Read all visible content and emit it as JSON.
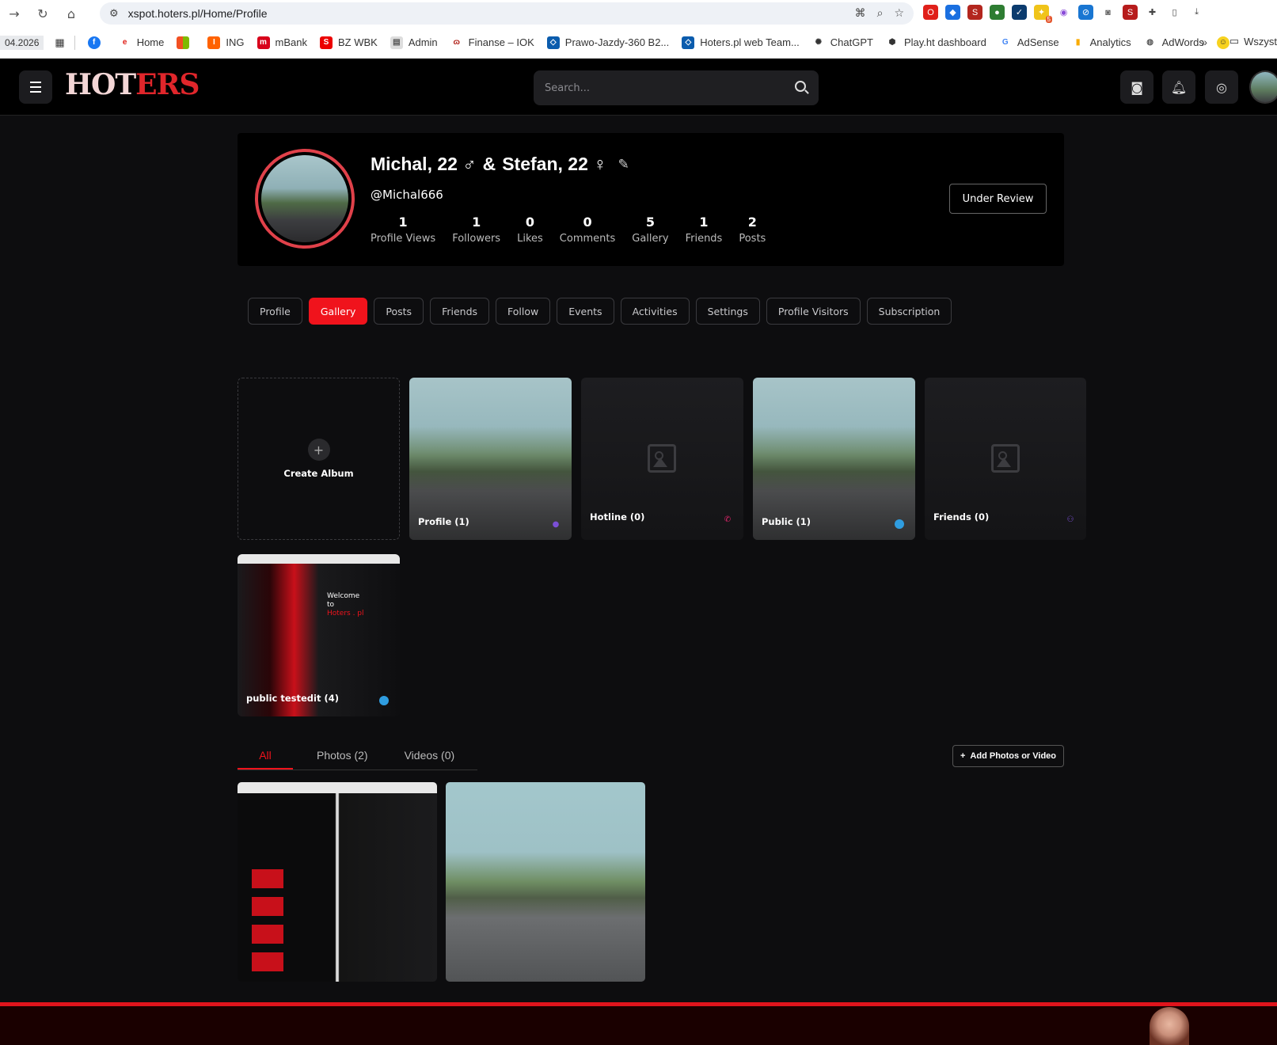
{
  "browser": {
    "url": "xspot.hoters.pl/Home/Profile",
    "bookmarks_date": "04.2026",
    "bookmarks": [
      "Home",
      "ING",
      "mBank",
      "BZ WBK",
      "Admin",
      "Finanse – IOK",
      "Prawo-Jazdy-360 B2...",
      "Hoters.pl web Team...",
      "ChatGPT",
      "Play.ht dashboard",
      "AdSense",
      "Analytics",
      "AdWords"
    ],
    "bookmark_folder": "Wszyst",
    "ext_badge": "5"
  },
  "header": {
    "logo_part1": "HOT",
    "logo_part2": "ERS",
    "search_placeholder": "Search..."
  },
  "profile": {
    "name_part1": "Michal, 22 ♂",
    "name_amp": "&",
    "name_part2": "Stefan, 22 ♀",
    "handle": "@Michal666",
    "stats": [
      {
        "num": "1",
        "label": "Profile Views"
      },
      {
        "num": "1",
        "label": "Followers"
      },
      {
        "num": "0",
        "label": "Likes"
      },
      {
        "num": "0",
        "label": "Comments"
      },
      {
        "num": "5",
        "label": "Gallery"
      },
      {
        "num": "1",
        "label": "Friends"
      },
      {
        "num": "2",
        "label": "Posts"
      }
    ],
    "review_label": "Under Review"
  },
  "tabs": [
    "Profile",
    "Gallery",
    "Posts",
    "Friends",
    "Follow",
    "Events",
    "Activities",
    "Settings",
    "Profile Visitors",
    "Subscription"
  ],
  "active_tab": "Gallery",
  "albums": {
    "create_label": "Create Album",
    "items": [
      {
        "label": "Profile (1)",
        "badge_color": "#7b4fd6"
      },
      {
        "label": "Hotline (0)",
        "badge_color": "#e2266b"
      },
      {
        "label": "Public (1)",
        "badge_color": "#2f9de0"
      },
      {
        "label": "Friends (0)",
        "badge_color": "#7b4fd6"
      },
      {
        "label": "public testedit (4)",
        "badge_color": "#2f9de0"
      }
    ],
    "screens_welcome": [
      "Welcome",
      "to",
      "Hoters . pl"
    ]
  },
  "media_tabs": [
    "All",
    "Photos (2)",
    "Videos (0)"
  ],
  "add_media_label": "Add Photos or Video",
  "colors": {
    "accent": "#f0131c",
    "background": "#0d0d0f",
    "card": "#000000"
  }
}
